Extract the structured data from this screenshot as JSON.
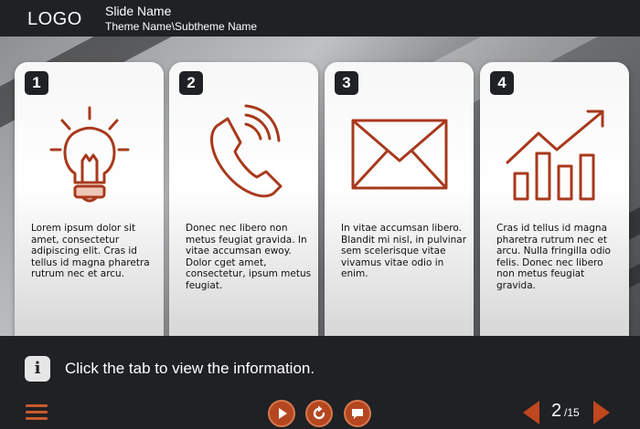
{
  "header": {
    "logo": "LOGO",
    "slide_name": "Slide Name",
    "theme_name": "Theme Name\\Subtheme Name"
  },
  "accent_color": "#b4471f",
  "cards": [
    {
      "number": "1",
      "icon": "lightbulb-icon",
      "text": "Lorem ipsum dolor sit amet, consectetur adipiscing elit. Cras id tellus id magna pharetra rutrum nec et arcu."
    },
    {
      "number": "2",
      "icon": "phone-icon",
      "text": "Donec nec libero non metus feugiat gravida. In vitae accumsan ewoy. Dolor cget amet, consectetur, ipsum metus feugiat."
    },
    {
      "number": "3",
      "icon": "envelope-icon",
      "text": "In vitae accumsan libero. Blandit mi nisl, in pulvinar sem scelerisque vitae vivamus vitae odio in enim."
    },
    {
      "number": "4",
      "icon": "growth-chart-icon",
      "text": "Cras id tellus id magna pharetra rutrum nec et arcu. Nulla fringilla odio felis. Donec nec libero non metus feugiat gravida."
    }
  ],
  "instruction": {
    "icon": "info-icon",
    "text": "Click the tab to view the information."
  },
  "nav": {
    "menu_icon": "hamburger-icon",
    "buttons": [
      "play-icon",
      "replay-icon",
      "chat-icon"
    ],
    "current_page": "2",
    "total_pages": "/15"
  }
}
